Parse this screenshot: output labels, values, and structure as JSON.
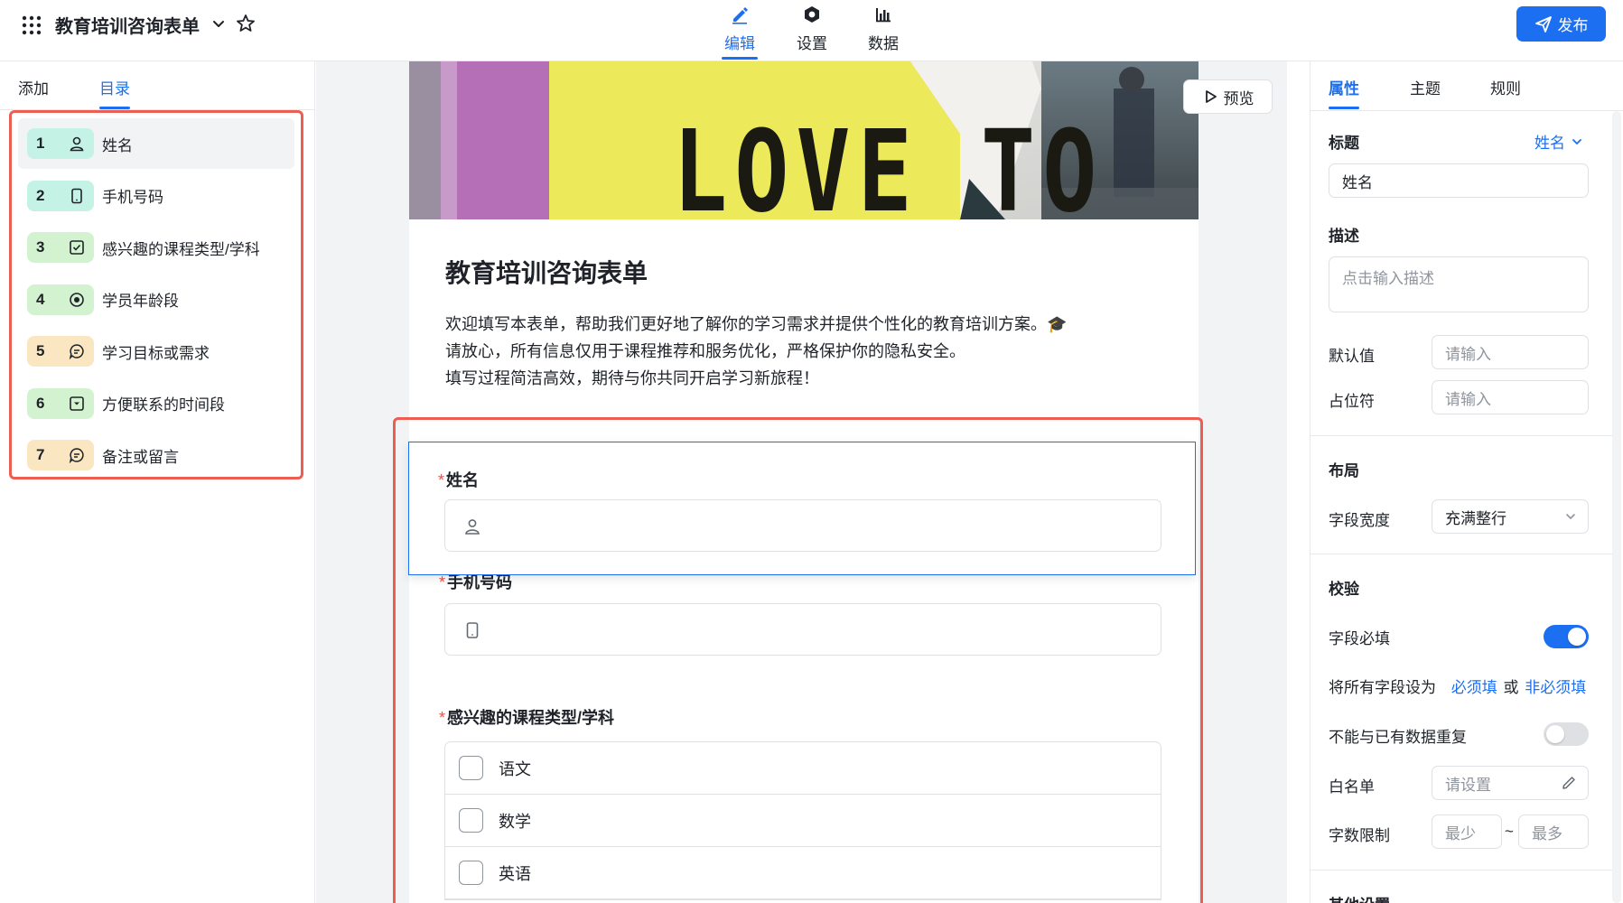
{
  "header": {
    "title": "教育培训咨询表单",
    "tabs": [
      {
        "label": "编辑",
        "icon": "pen-icon",
        "active": true
      },
      {
        "label": "设置",
        "icon": "gear-hexagon-icon",
        "active": false
      },
      {
        "label": "数据",
        "icon": "bar-chart-icon",
        "active": false
      }
    ],
    "publish_label": "发布"
  },
  "left": {
    "tabs": [
      {
        "label": "添加",
        "active": false
      },
      {
        "label": "目录",
        "active": true
      }
    ],
    "items": [
      {
        "num": "1",
        "label": "姓名",
        "icon": "user-icon",
        "color": "#c4f2e4"
      },
      {
        "num": "2",
        "label": "手机号码",
        "icon": "phone-icon",
        "color": "#c4f2e4"
      },
      {
        "num": "3",
        "label": "感兴趣的课程类型/学科",
        "icon": "checkbox-icon",
        "color": "#d3f2d0"
      },
      {
        "num": "4",
        "label": "学员年龄段",
        "icon": "radio-icon",
        "color": "#d3f2d0"
      },
      {
        "num": "5",
        "label": "学习目标或需求",
        "icon": "comment-icon",
        "color": "#fbe6c2"
      },
      {
        "num": "6",
        "label": "方便联系的时间段",
        "icon": "dropdown-box-icon",
        "color": "#d3f2d0"
      },
      {
        "num": "7",
        "label": "备注或留言",
        "icon": "comment-icon",
        "color": "#fbe6c2"
      }
    ]
  },
  "center": {
    "preview_label": "预览",
    "banner_text": "LOVE TO",
    "form_title": "教育培训咨询表单",
    "description": "欢迎填写本表单，帮助我们更好地了解你的学习需求并提供个性化的教育培训方案。🎓\n请放心，所有信息仅用于课程推荐和服务优化，严格保护你的隐私安全。\n填写过程简洁高效，期待与你共同开启学习新旅程！",
    "required_mark": "*",
    "fields": {
      "name_label": "姓名",
      "phone_label": "手机号码",
      "course_label": "感兴趣的课程类型/学科",
      "course_options": [
        "语文",
        "数学",
        "英语"
      ]
    }
  },
  "right": {
    "tabs": [
      {
        "label": "属性",
        "active": true
      },
      {
        "label": "主题",
        "active": false
      },
      {
        "label": "规则",
        "active": false
      }
    ],
    "title_section": "标题",
    "title_link": "姓名",
    "title_value": "姓名",
    "desc_section": "描述",
    "desc_placeholder": "点击输入描述",
    "default_label": "默认值",
    "default_placeholder": "请输入",
    "placeholder_label": "占位符",
    "placeholder_placeholder": "请输入",
    "layout_section": "布局",
    "width_label": "字段宽度",
    "width_value": "充满整行",
    "validation_section": "校验",
    "required_label": "字段必填",
    "required_on": true,
    "set_all_label": "将所有字段设为",
    "set_required": "必须填",
    "or_text": "或",
    "set_optional": "非必须填",
    "unique_label": "不能与已有数据重复",
    "unique_on": false,
    "whitelist_label": "白名单",
    "whitelist_placeholder": "请设置",
    "charlimit_label": "字数限制",
    "min_placeholder": "最少",
    "tilde": "~",
    "max_placeholder": "最多",
    "other_section": "其他设置"
  },
  "colors": {
    "accent": "#1d6ff2",
    "highlight_frame": "#eb5e51",
    "required": "#f54a45"
  }
}
